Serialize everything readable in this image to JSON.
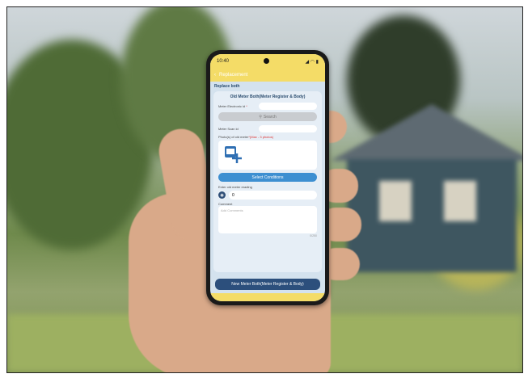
{
  "status_bar": {
    "time": "10:40",
    "icons": "signal wifi battery"
  },
  "app_bar": {
    "back_icon": "chevron-left-icon",
    "title": "Replacement"
  },
  "section_title": "Replace both",
  "card": {
    "title": "Old Meter Both(Meter Register & Body)",
    "meter_serial_label": "Meter Electronic id",
    "meter_serial_required": "*",
    "search_button": "Search",
    "meter_scan_label": "Meter Scan id",
    "photos_label": "Photo(s) of old meter",
    "photos_hint": "*(Max - 3 photos)",
    "select_conditions_button": "Select Conditions",
    "reading_label": "Enter old meter reading",
    "reading_value": "0",
    "comment_label": "Comment",
    "comment_placeholder": "Add Comments",
    "char_counter": "0/250"
  },
  "bottom_button": "New Meter Both(Meter Register & Body)"
}
